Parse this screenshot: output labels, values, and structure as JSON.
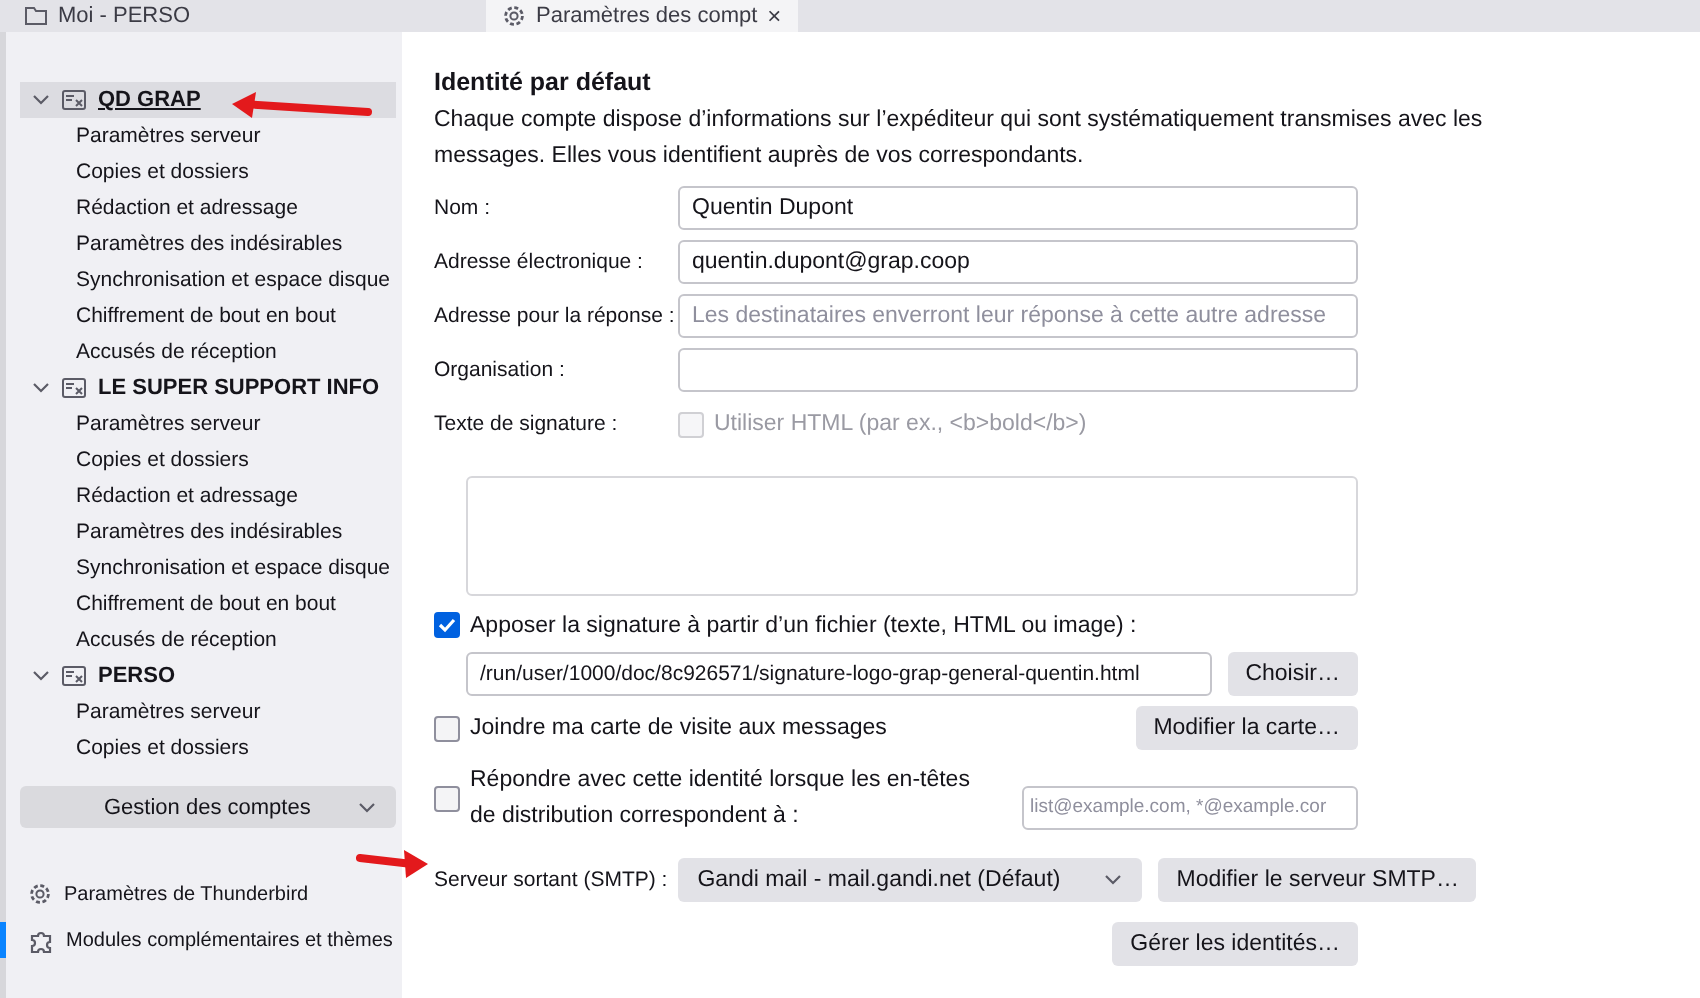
{
  "tabs": [
    {
      "label": "Moi - PERSO",
      "selected": false
    },
    {
      "label": "Paramètres des compt",
      "selected": true,
      "close": "×"
    }
  ],
  "sidebar": {
    "accounts": [
      {
        "name": "QD GRAP",
        "expanded": true,
        "selected": true,
        "children": [
          {
            "label": "Paramètres serveur",
            "selected": false
          },
          {
            "label": "Copies et dossiers",
            "selected": false
          },
          {
            "label": "Rédaction et adressage",
            "selected": false
          },
          {
            "label": "Paramètres des indésirables",
            "selected": false
          },
          {
            "label": "Synchronisation et espace disque",
            "selected": false
          },
          {
            "label": "Chiffrement de bout en bout",
            "selected": false
          },
          {
            "label": "Accusés de réception",
            "selected": false
          }
        ]
      },
      {
        "name": "LE SUPER SUPPORT INFO",
        "expanded": true,
        "selected": false,
        "children": [
          {
            "label": "Paramètres serveur",
            "selected": false
          },
          {
            "label": "Copies et dossiers",
            "selected": false
          },
          {
            "label": "Rédaction et adressage",
            "selected": false
          },
          {
            "label": "Paramètres des indésirables",
            "selected": false
          },
          {
            "label": "Synchronisation et espace disque",
            "selected": false
          },
          {
            "label": "Chiffrement de bout en bout",
            "selected": false
          },
          {
            "label": "Accusés de réception",
            "selected": false
          }
        ]
      },
      {
        "name": "PERSO",
        "expanded": true,
        "selected": false,
        "children": [
          {
            "label": "Paramètres serveur",
            "selected": false
          },
          {
            "label": "Copies et dossiers",
            "selected": false
          }
        ]
      }
    ],
    "manage_button": "Gestion des comptes",
    "footer": [
      {
        "label": "Paramètres de Thunderbird"
      },
      {
        "label": "Modules complémentaires et thèmes"
      }
    ]
  },
  "form": {
    "heading": "Identité par défaut",
    "description": "Chaque compte dispose d’informations sur l’expéditeur qui sont systématiquement transmises avec les messages. Elles vous identifient auprès de vos correspondants.",
    "fields": [
      {
        "label": "Nom :",
        "value": "Quentin Dupont"
      },
      {
        "label": "Adresse électronique :",
        "value": "quentin.dupont@grap.coop"
      },
      {
        "label": "Adresse pour la réponse :",
        "placeholder": "Les destinataires enverront leur réponse à cette autre adresse"
      },
      {
        "label": "Organisation :"
      }
    ],
    "signature": {
      "label": "Texte de signature :",
      "html_option": {
        "label": "Utiliser HTML (par ex., <b>bold</b>)",
        "checked": false,
        "disabled": true
      }
    },
    "attach_file": {
      "label": "Apposer la signature à partir d’un fichier (texte, HTML ou image) :",
      "checked": true,
      "path": "/run/user/1000/doc/8c926571/signature-logo-grap-general-quentin.html",
      "button": "Choisir…"
    },
    "vcard": {
      "label": "Joindre ma carte de visite aux messages",
      "checked": false,
      "button": "Modifier la carte…"
    },
    "reply_match": {
      "label": "Répondre avec cette identité lorsque les en-têtes de distribution correspondent à :",
      "checked": false,
      "placeholder": "list@example.com, *@example.cor"
    },
    "smtp": {
      "label": "Serveur sortant (SMTP) :",
      "value": "Gandi mail - mail.gandi.net (Défaut)",
      "button": "Modifier le serveur SMTP…"
    },
    "manage_identities": "Gérer les identités…"
  }
}
